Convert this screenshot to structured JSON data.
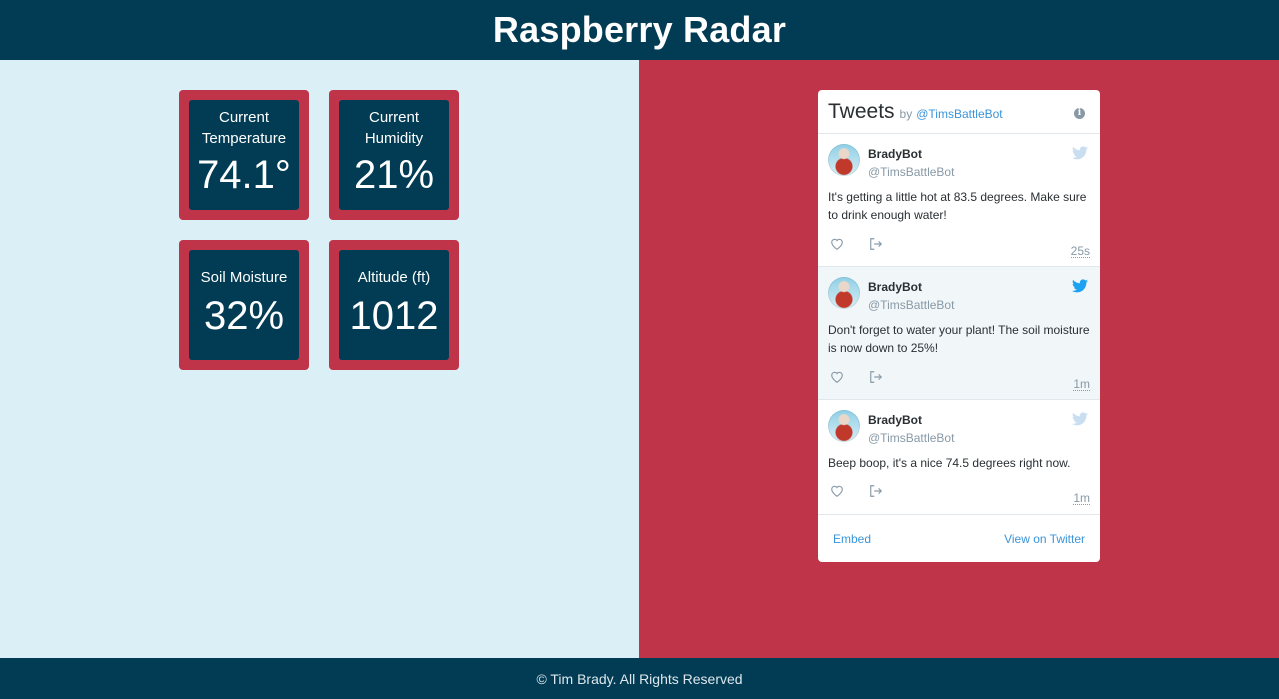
{
  "header": {
    "title": "Raspberry Radar"
  },
  "sensors": [
    {
      "label": "Current Temperature",
      "value": "74.1°"
    },
    {
      "label": "Current Humidity",
      "value": "21%"
    },
    {
      "label": "Soil Moisture",
      "value": "32%"
    },
    {
      "label": "Altitude (ft)",
      "value": "1012"
    }
  ],
  "twitter": {
    "title": "Tweets",
    "by": "by",
    "handle": "@TimsBattleBot",
    "info_icon": "i",
    "tweets": [
      {
        "name": "BradyBot",
        "handle": "@TimsBattleBot",
        "text": "It's getting a little hot at 83.5 degrees. Make sure to drink enough water!",
        "time": "25s"
      },
      {
        "name": "BradyBot",
        "handle": "@TimsBattleBot",
        "text": "Don't forget to water your plant! The soil moisture is now down to 25%!",
        "time": "1m"
      },
      {
        "name": "BradyBot",
        "handle": "@TimsBattleBot",
        "text": "Beep boop, it's a nice 74.5 degrees right now.",
        "time": "1m"
      }
    ],
    "embed_label": "Embed",
    "view_label": "View on Twitter"
  },
  "footer": {
    "text": "© Tim Brady. All Rights Reserved"
  },
  "colors": {
    "navy": "#023c54",
    "red": "#bf3449",
    "light": "#dbeff7",
    "twitter_blue": "#1da1f2"
  }
}
